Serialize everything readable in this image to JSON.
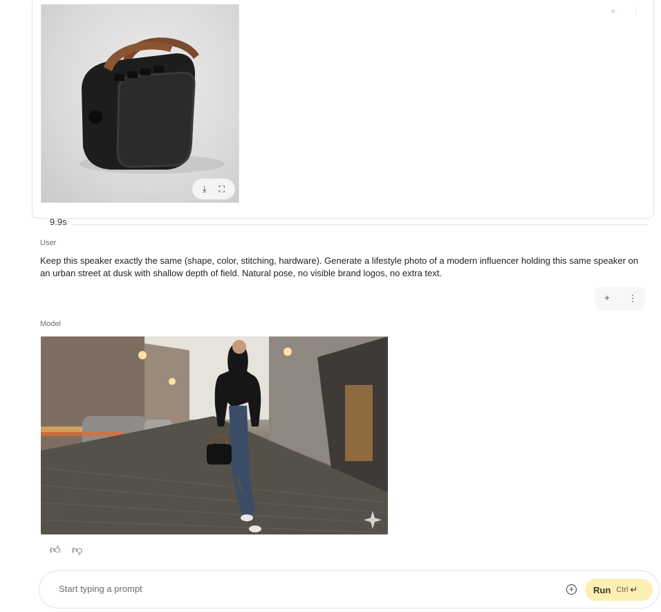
{
  "top_card": {
    "image_alt": "Black portable speaker with brown leather strap",
    "tools": {
      "download_icon": "download-icon",
      "fullscreen_icon": "fullscreen-icon"
    },
    "timing": "9.9s"
  },
  "user_message": {
    "role": "User",
    "text": "Keep this speaker exactly the same (shape, color, stitching, hardware). Generate a lifestyle photo of a modern influencer holding this same speaker on an urban street at dusk with shallow depth of field. Natural pose, no visible brand logos, no extra text.",
    "actions": {
      "sparkle_icon": "sparkle-icon",
      "more_icon": "more-vert-icon"
    }
  },
  "model_message": {
    "role": "Model",
    "image_alt": "Woman walking on cobblestone street at dusk holding the speaker"
  },
  "feedback": {
    "thumbs_up": "thumbs-up-icon",
    "thumbs_down": "thumbs-down-icon"
  },
  "prompt": {
    "placeholder": "Start typing a prompt",
    "value": "",
    "run_label": "Run",
    "shortcut": "Ctrl"
  }
}
